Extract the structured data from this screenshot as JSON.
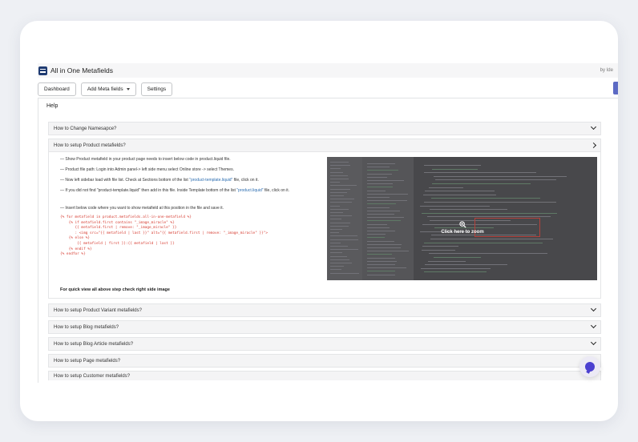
{
  "app": {
    "title": "All in One Metafields",
    "by_text": "by Ide"
  },
  "toolbar": {
    "dashboard": "Dashboard",
    "add_meta_fields": "Add Meta fields",
    "settings": "Settings"
  },
  "help": {
    "title": "Help",
    "sections": [
      {
        "label": "How to Change Namesapce?",
        "state": "collapsed"
      },
      {
        "label": "How to setup Product metafields?",
        "state": "expanded"
      },
      {
        "label": "How to setup Product Variant metafields?",
        "state": "collapsed"
      },
      {
        "label": "How to setup Blog metafields?",
        "state": "collapsed"
      },
      {
        "label": "How to setup Blog Article metafields?",
        "state": "collapsed"
      },
      {
        "label": "How to setup Page metafields?",
        "state": "collapsed"
      },
      {
        "label": "How to setup Customer metafields?",
        "state": "collapsed"
      }
    ],
    "product_steps": {
      "step1": "— Show Product metafield in your product page needs to insert below code in product.liquid file.",
      "step2": "— Product file path: Login into Admin panel-> left side menu select Online store -> select Themes.",
      "step3_a": "— Now left sidebar load with file list. Check at Sections bottom of the list ",
      "step3_link": "\"product-template.liquid\"",
      "step3_b": " file, click on it.",
      "step4_a": "— If you did not find \"product-template.liquid\" then add in this file. Inside Template bottom of the list ",
      "step4_link": "\"product.liquid\"",
      "step4_b": " file, click on it.",
      "step5": "— Insert below code where you want to show metafield at this position in the file and save it.",
      "code": "{% for metafield in product.metafields.all-in-one-metafield %}\n    {% if metafield.first contains \"_image_miracle\" %}\n       {{ metafield.first | remove: \"_image_miracle\" }}\n       : <img src=\"{{ metafield | last }}\" alt=\"{{ metafield.first | remove: \"_image_miracle\" }}\">\n    {% else %}\n        {{ metafield | first }}:{{ metafield | last }}\n    {% endif %}\n{% endfor %}",
      "note": "For quick view all above step check right side image",
      "zoom_label": "Click here to zoom"
    }
  },
  "icons": {
    "logo": "app-logo-icon",
    "zoom": "zoom-in-icon",
    "chat": "chat-bubble-icon"
  },
  "colors": {
    "code": "#d63a2f",
    "link": "#2b6cb0",
    "accent": "#5c6ac4",
    "chat": "#4b3fd0"
  }
}
